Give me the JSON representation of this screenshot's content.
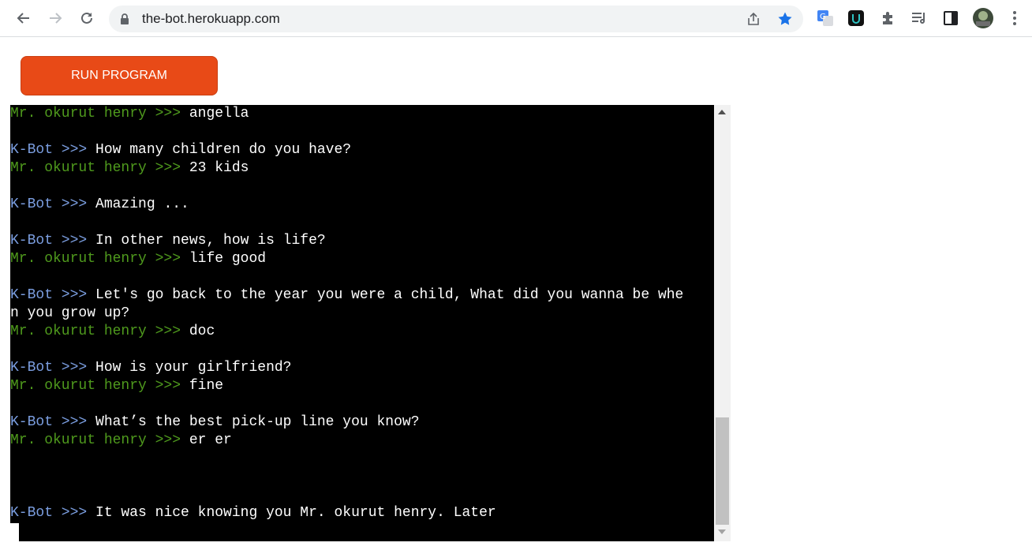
{
  "browser": {
    "url": "the-bot.herokuapp.com",
    "accent_color": "#1a73e8"
  },
  "app": {
    "run_button_label": "RUN PROGRAM",
    "run_button_color": "#e84a17"
  },
  "terminal": {
    "bot_prompt": "K-Bot >>> ",
    "user_prompt": "Mr. okurut henry >>> ",
    "colors": {
      "background": "#000000",
      "bot_prompt": "#7b9ee0",
      "user_prompt": "#4f9a1d",
      "text": "#ffffff"
    },
    "lines": [
      {
        "speaker": "user",
        "text": "angella"
      },
      {
        "speaker": "bot",
        "text": "How many children do you have?"
      },
      {
        "speaker": "user",
        "text": "23 kids"
      },
      {
        "speaker": "bot",
        "text": "Amazing ..."
      },
      {
        "speaker": "bot",
        "text": "In other news, how is life?"
      },
      {
        "speaker": "user",
        "text": "life good"
      },
      {
        "speaker": "bot",
        "text": "Let's go back to the year you were a child, What did you wanna be whe"
      },
      {
        "speaker": "none",
        "text": "n you grow up?"
      },
      {
        "speaker": "user",
        "text": "doc"
      },
      {
        "speaker": "bot",
        "text": "How is your girlfriend?"
      },
      {
        "speaker": "user",
        "text": "fine"
      },
      {
        "speaker": "bot",
        "text": "What’s the best pick-up line you know?"
      },
      {
        "speaker": "user",
        "text": "er er"
      },
      {
        "speaker": "bot",
        "text": "It was nice knowing you Mr. okurut henry. Later"
      }
    ]
  }
}
